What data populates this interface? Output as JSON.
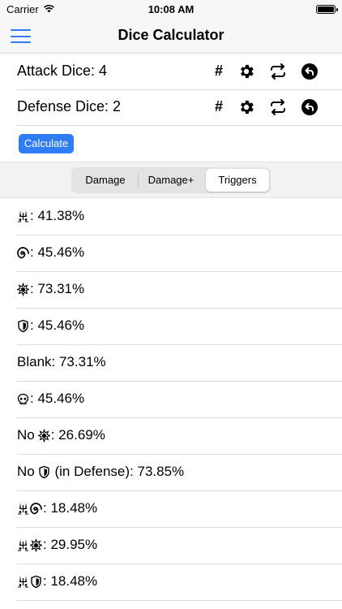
{
  "status": {
    "carrier": "Carrier",
    "time": "10:08 AM"
  },
  "nav": {
    "title": "Dice Calculator"
  },
  "attack": {
    "label": "Attack Dice: 4",
    "hash": "#"
  },
  "defense": {
    "label": "Defense Dice: 2",
    "hash": "#"
  },
  "calculate_label": "Calculate",
  "tabs": [
    {
      "label": "Damage"
    },
    {
      "label": "Damage+"
    },
    {
      "label": "Triggers"
    }
  ],
  "selected_tab": "Triggers",
  "results": [
    {
      "icons": [
        "crit-icon"
      ],
      "text": ": 41.38%"
    },
    {
      "icons": [
        "surge-icon"
      ],
      "text": ": 45.46%"
    },
    {
      "icons": [
        "hit-icon"
      ],
      "text": ": 73.31%"
    },
    {
      "icons": [
        "shield-icon"
      ],
      "text": ": 45.46%"
    },
    {
      "prefix": "Blank",
      "icons": [],
      "text": ": 73.31%"
    },
    {
      "icons": [
        "skull-icon"
      ],
      "text": ": 45.46%"
    },
    {
      "prefix": "No",
      "icons": [
        "hit-icon"
      ],
      "text": ": 26.69%"
    },
    {
      "prefix": "No",
      "icons": [
        "shield-icon"
      ],
      "text": " (in Defense): 73.85%"
    },
    {
      "icons": [
        "crit-icon",
        "surge-icon"
      ],
      "text": ": 18.48%"
    },
    {
      "icons": [
        "crit-icon",
        "hit-icon"
      ],
      "text": ": 29.95%"
    },
    {
      "icons": [
        "crit-icon",
        "shield-icon"
      ],
      "text": ": 18.48%"
    }
  ],
  "colors": {
    "accent": "#2f7df6",
    "segment_bg": "#e3e3e6",
    "list_divider": "#dcdcdc"
  }
}
